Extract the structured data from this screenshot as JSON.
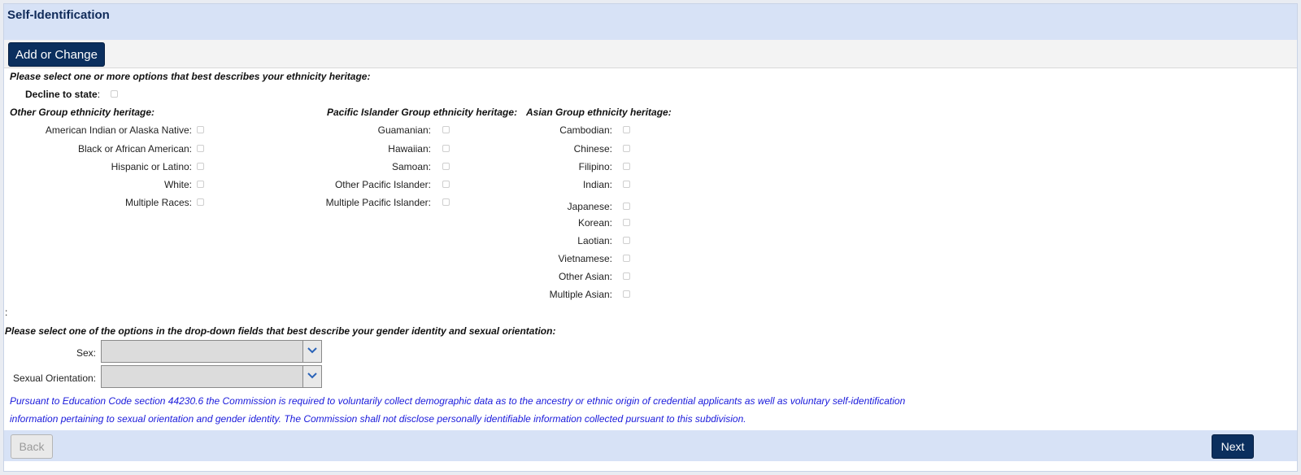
{
  "header": {
    "title": "Self-Identification"
  },
  "actions": {
    "add_or_change_label": "Add or Change"
  },
  "ethnicity": {
    "instruction": "Please select one or more options that best describes your ethnicity heritage:",
    "decline_label": "Decline to state",
    "decline_colon": ":",
    "groups": [
      {
        "heading": "Other Group ethnicity heritage:",
        "options": [
          "American Indian or Alaska Native:",
          "Black or African American:",
          "Hispanic or Latino:",
          "White:",
          "Multiple Races:"
        ]
      },
      {
        "heading": "Pacific Islander Group ethnicity heritage:",
        "options": [
          "Guamanian:",
          "Hawaiian:",
          "Samoan:",
          "Other Pacific Islander:",
          "Multiple Pacific Islander:"
        ]
      },
      {
        "heading": "Asian Group ethnicity heritage:",
        "options": [
          "Cambodian:",
          "Chinese:",
          "Filipino:",
          "Indian:",
          "Japanese:",
          "Korean:",
          "Laotian:",
          "Vietnamese:",
          "Other Asian:",
          "Multiple Asian:"
        ]
      }
    ],
    "separator": ":"
  },
  "gender": {
    "instruction": "Please select one of the options in the drop-down fields that best describe your gender identity and sexual orientation:",
    "sex_label": "Sex:",
    "sex_value": "",
    "orientation_label": "Sexual Orientation:",
    "orientation_value": ""
  },
  "disclaimer": "Pursuant to Education Code section 44230.6 the Commission is required to voluntarily collect demographic data as to the ancestry or ethnic origin of credential applicants as well as voluntary self-identification information pertaining to sexual orientation and gender identity. The Commission shall not disclose personally identifiable information collected pursuant to this subdivision.",
  "footer": {
    "back_label": "Back",
    "next_label": "Next"
  },
  "colors": {
    "primary": "#0b2f5e",
    "header_bg": "#d7e2f6",
    "disclaimer_text": "#1a1adb"
  }
}
